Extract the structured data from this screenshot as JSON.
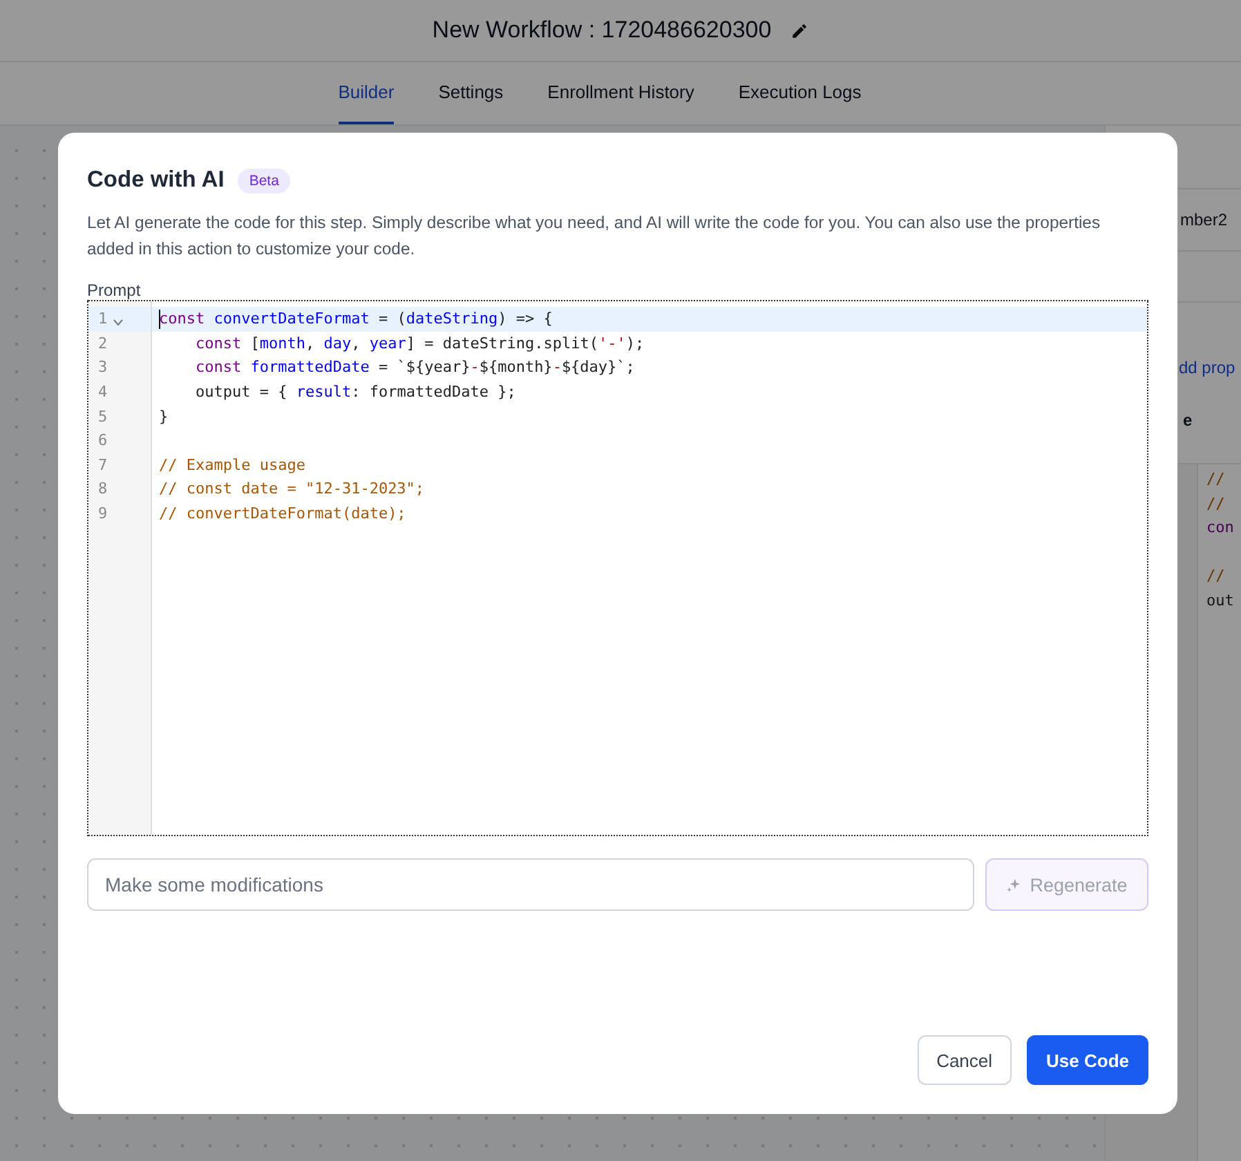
{
  "header": {
    "title": "New Workflow : 1720486620300"
  },
  "tabs": [
    {
      "label": "Builder",
      "selected": true
    },
    {
      "label": "Settings",
      "selected": false
    },
    {
      "label": "Enrollment History",
      "selected": false
    },
    {
      "label": "Execution Logs",
      "selected": false
    }
  ],
  "side_panel": {
    "field_value": "mber2",
    "link": "dd prop",
    "heading": "e",
    "code_groups": [
      {
        "lines": [
          {
            "text": "//",
            "kind": "comment"
          },
          {
            "text": "//",
            "kind": "comment"
          },
          {
            "text": "con",
            "kind": "keyword"
          }
        ]
      },
      {
        "lines": [
          {
            "text": "//",
            "kind": "comment"
          },
          {
            "text": "out",
            "kind": "plain"
          }
        ]
      }
    ]
  },
  "dialog": {
    "title": "Code with AI",
    "badge": "Beta",
    "description": "Let AI generate the code for this step. Simply describe what you need, and AI will write the code for you. You can also use the properties added in this action to customize your code.",
    "prompt_label": "Prompt",
    "code": [
      {
        "number": "1",
        "active": true,
        "foldable": true,
        "indented": false,
        "tokens": [
          {
            "text": "const ",
            "kind": "keyword"
          },
          {
            "text": "convertDateFormat",
            "kind": "def"
          },
          {
            "text": " = (",
            "kind": "plain"
          },
          {
            "text": "dateString",
            "kind": "def"
          },
          {
            "text": ") => {",
            "kind": "plain"
          }
        ]
      },
      {
        "number": "2",
        "active": false,
        "foldable": false,
        "indented": true,
        "tokens": [
          {
            "text": "const",
            "kind": "keyword"
          },
          {
            "text": " [",
            "kind": "plain"
          },
          {
            "text": "month",
            "kind": "def"
          },
          {
            "text": ", ",
            "kind": "plain"
          },
          {
            "text": "day",
            "kind": "def"
          },
          {
            "text": ", ",
            "kind": "plain"
          },
          {
            "text": "year",
            "kind": "def"
          },
          {
            "text": "] = dateString.split(",
            "kind": "plain"
          },
          {
            "text": "'-'",
            "kind": "string"
          },
          {
            "text": ");",
            "kind": "plain"
          }
        ]
      },
      {
        "number": "3",
        "active": false,
        "foldable": false,
        "indented": true,
        "tokens": [
          {
            "text": "const ",
            "kind": "keyword"
          },
          {
            "text": "formattedDate",
            "kind": "def"
          },
          {
            "text": " = `${year}",
            "kind": "plain"
          },
          {
            "text": "-",
            "kind": "string"
          },
          {
            "text": "${month}",
            "kind": "plain"
          },
          {
            "text": "-",
            "kind": "string"
          },
          {
            "text": "${day}`;",
            "kind": "plain"
          }
        ]
      },
      {
        "number": "4",
        "active": false,
        "foldable": false,
        "indented": true,
        "tokens": [
          {
            "text": "output = { ",
            "kind": "plain"
          },
          {
            "text": "result",
            "kind": "property"
          },
          {
            "text": ": formattedDate };",
            "kind": "plain"
          }
        ]
      },
      {
        "number": "5",
        "active": false,
        "foldable": false,
        "indented": false,
        "tokens": [
          {
            "text": "}",
            "kind": "plain"
          }
        ]
      },
      {
        "number": "6",
        "active": false,
        "foldable": false
      },
      {
        "number": "7",
        "active": false,
        "foldable": false,
        "indented": false,
        "tokens": [
          {
            "text": "// Example usage",
            "kind": "comment"
          }
        ]
      },
      {
        "number": "8",
        "active": false,
        "foldable": false,
        "indented": false,
        "tokens": [
          {
            "text": "// const date = \"12-31-2023\";",
            "kind": "comment"
          }
        ]
      },
      {
        "number": "9",
        "active": false,
        "foldable": false,
        "indented": false,
        "tokens": [
          {
            "text": "// convertDateFormat(date);",
            "kind": "comment"
          }
        ]
      }
    ],
    "modify_field": {
      "placeholder": "Make some modifications"
    },
    "regenerate_button": {
      "label": "Regenerate",
      "disabled": true
    },
    "buttons": [
      {
        "label": "Cancel",
        "kind": "secondary"
      },
      {
        "label": "Use Code",
        "kind": "primary"
      }
    ]
  }
}
